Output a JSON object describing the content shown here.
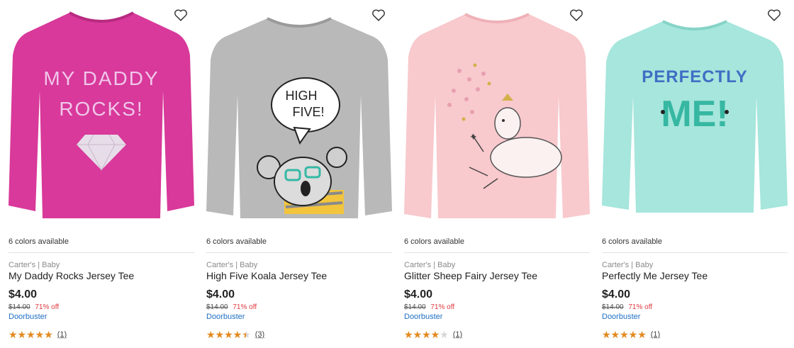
{
  "products": [
    {
      "colors_available": "6 colors available",
      "brand": "Carter's | Baby",
      "title": "My Daddy Rocks Jersey Tee",
      "price": "$4.00",
      "was_price": "$14.00",
      "discount": "71% off",
      "promo": "Doorbuster",
      "rating": 5,
      "review_count": "(1)",
      "shirt_color": "#d8399a",
      "graphic_text": [
        "MY DADDY",
        "ROCKS!"
      ],
      "icon": "diamond-graphic"
    },
    {
      "colors_available": "6 colors available",
      "brand": "Carter's | Baby",
      "title": "High Five Koala Jersey Tee",
      "price": "$4.00",
      "was_price": "$14.00",
      "discount": "71% off",
      "promo": "Doorbuster",
      "rating": 4.5,
      "review_count": "(3)",
      "shirt_color": "#b9b9b9",
      "graphic_text": [
        "HIGH",
        "FIVE!"
      ],
      "icon": "koala-graphic"
    },
    {
      "colors_available": "6 colors available",
      "brand": "Carter's | Baby",
      "title": "Glitter Sheep Fairy Jersey Tee",
      "price": "$4.00",
      "was_price": "$14.00",
      "discount": "71% off",
      "promo": "Doorbuster",
      "rating": 4,
      "review_count": "(1)",
      "shirt_color": "#f8c9cd",
      "graphic_text": [],
      "icon": "sheep-graphic"
    },
    {
      "colors_available": "6 colors available",
      "brand": "Carter's | Baby",
      "title": "Perfectly Me Jersey Tee",
      "price": "$4.00",
      "was_price": "$14.00",
      "discount": "71% off",
      "promo": "Doorbuster",
      "rating": 5,
      "review_count": "(1)",
      "shirt_color": "#a6e6dc",
      "graphic_text": [
        "PERFECTLY",
        "ME!"
      ],
      "icon": "perfectly-me-graphic"
    }
  ],
  "colors": {
    "star": "#e58a1e",
    "discount": "#e0383e",
    "promo_link": "#1f6fc4"
  }
}
